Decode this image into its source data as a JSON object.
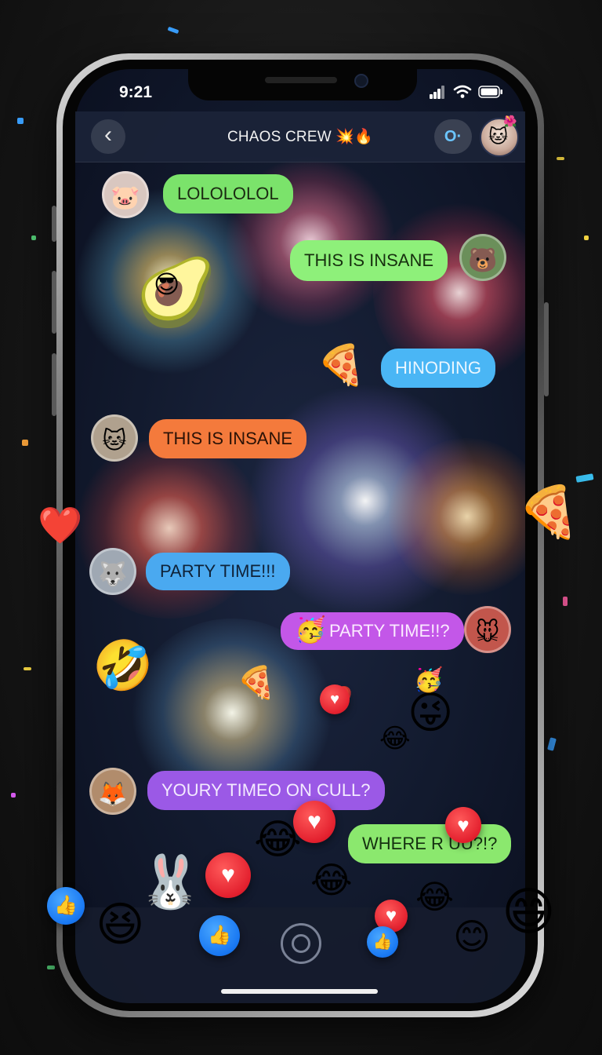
{
  "status": {
    "time": "9:21"
  },
  "header": {
    "back_glyph": "‹",
    "title": "CHAOS CREW 💥🔥",
    "call_icon": "video-call-icon",
    "call_glyph": "O·",
    "avatar_icon": "cat-avatar-icon"
  },
  "messages": [
    {
      "text": "LOLOLOLOL",
      "side": "left",
      "color": "#7be36b",
      "text_color": "#1b2a12",
      "avatar": "🐷"
    },
    {
      "text": "THIS IS INSANE",
      "side": "right",
      "color": "#8ef07a",
      "text_color": "#17300f",
      "avatar": "🐻"
    },
    {
      "text": "HINODING",
      "side": "right",
      "color": "#4ab6f5",
      "text_color": "#eaf6ff"
    },
    {
      "text": "THIS IS INSANE",
      "side": "left",
      "color": "#f47a3c",
      "text_color": "#2b1206",
      "avatar": "🐱"
    },
    {
      "text": "PARTY TIME!!!",
      "side": "left",
      "color": "#4aa9f0",
      "text_color": "#0f2238",
      "avatar": "🐺"
    },
    {
      "text": "PARTY TIME!!?",
      "side": "right",
      "color": "#c357e8",
      "text_color": "#fbeaff",
      "avatar": "🐭"
    },
    {
      "text": "YOURY TIMEO ON CULL?",
      "side": "left",
      "color": "#9b59e6",
      "text_color": "#f3eaff",
      "avatar": "🦊"
    },
    {
      "text": "WHERE R UU?!?",
      "side": "right",
      "color": "#8be86e",
      "text_color": "#143010"
    }
  ],
  "floating_emojis": [
    {
      "name": "avocado-sticker",
      "glyph": "🥑"
    },
    {
      "name": "sunglasses-emoji",
      "glyph": "😎"
    },
    {
      "name": "pizza-emoji",
      "glyph": "🍕"
    },
    {
      "name": "heart-emoji",
      "glyph": "❤️"
    },
    {
      "name": "rofl-emoji",
      "glyph": "🤣"
    },
    {
      "name": "tongue-emoji",
      "glyph": "😜"
    },
    {
      "name": "laughing-emoji",
      "glyph": "😂"
    },
    {
      "name": "grin-emoji",
      "glyph": "😆"
    },
    {
      "name": "smile-emoji",
      "glyph": "😄"
    },
    {
      "name": "blush-emoji",
      "glyph": "😊"
    },
    {
      "name": "party-hat-emoji",
      "glyph": "🥳"
    },
    {
      "name": "bunny-sticker",
      "glyph": "🐰"
    }
  ],
  "reactions": {
    "heart_glyph": "♥",
    "like_glyph": "👍"
  },
  "colors": {
    "screen_bg": "#121a2e",
    "heart": "#e3202e",
    "like": "#1877f2"
  }
}
